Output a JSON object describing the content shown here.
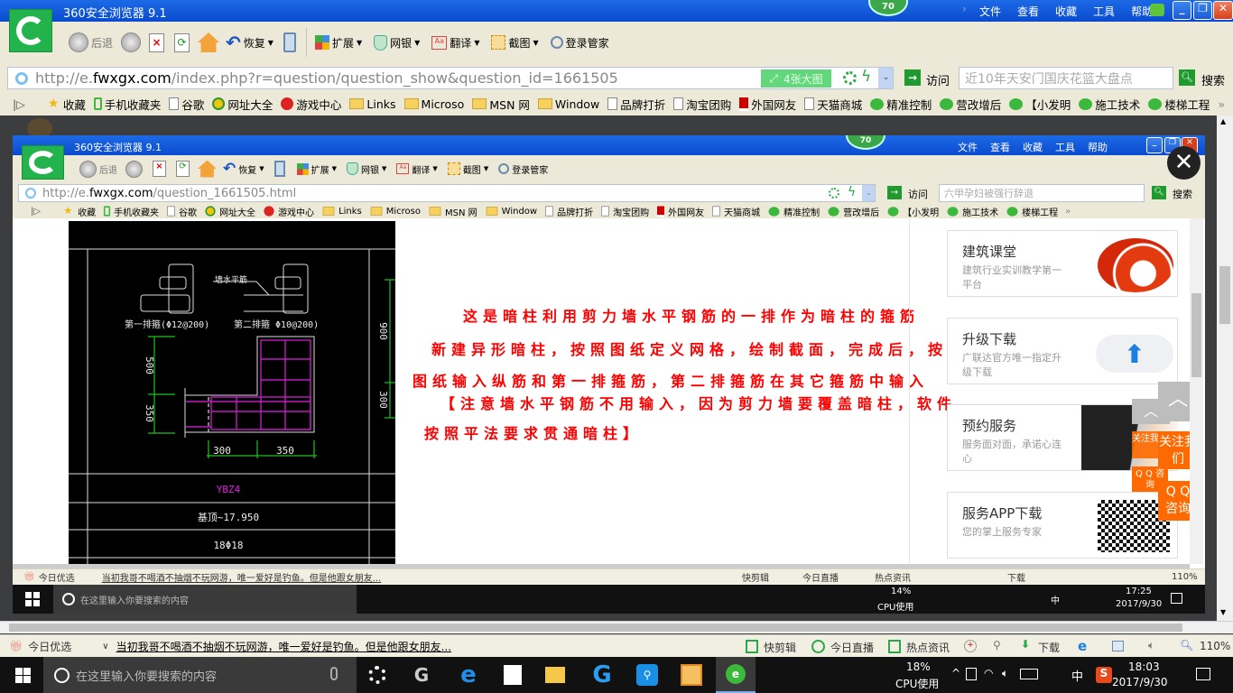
{
  "outer_browser": {
    "title": "360安全浏览器 9.1",
    "badge": "70",
    "menu": [
      "文件",
      "查看",
      "收藏",
      "工具",
      "帮助"
    ],
    "toolbar": {
      "back": "后退",
      "restore": "恢复",
      "extend": "扩展",
      "bank": "网银",
      "translate": "翻译",
      "screenshot": "截图",
      "login": "登录管家"
    },
    "address": {
      "prefix": "http://e.",
      "domain": "fwxgx.com",
      "path": "/index.php?r=question/question_show&question_id=1661505",
      "big_image": "4张大图",
      "go": "访问",
      "search_placeholder": "近10年天安门国庆花篮大盘点",
      "search": "搜索"
    },
    "bookmarks": [
      {
        "label": "收藏",
        "icon": "star"
      },
      {
        "label": "手机收藏夹",
        "icon": "phone"
      },
      {
        "label": "谷歌",
        "icon": "page"
      },
      {
        "label": "网址大全",
        "icon": "plus"
      },
      {
        "label": "游戏中心",
        "icon": "game"
      },
      {
        "label": "Links",
        "icon": "folder"
      },
      {
        "label": "Microso",
        "icon": "folder"
      },
      {
        "label": "MSN 网",
        "icon": "folder"
      },
      {
        "label": "Window",
        "icon": "folder"
      },
      {
        "label": "品牌打折",
        "icon": "page"
      },
      {
        "label": "淘宝团购",
        "icon": "page"
      },
      {
        "label": "外国网友",
        "icon": "flag"
      },
      {
        "label": "天猫商城",
        "icon": "page"
      },
      {
        "label": "精准控制",
        "icon": "wechat"
      },
      {
        "label": "营改增后",
        "icon": "wechat"
      },
      {
        "label": "【小发明",
        "icon": "wechat"
      },
      {
        "label": "施工技术",
        "icon": "wechat"
      },
      {
        "label": "楼梯工程",
        "icon": "wechat"
      }
    ]
  },
  "inner_browser": {
    "title": "360安全浏览器 9.1",
    "badge": "70",
    "menu": [
      "文件",
      "查看",
      "收藏",
      "工具",
      "帮助"
    ],
    "toolbar": {
      "back": "后退",
      "restore": "恢复",
      "extend": "扩展",
      "bank": "网银",
      "translate": "翻译",
      "screenshot": "截图",
      "login": "登录管家"
    },
    "address": {
      "prefix": "http://e.",
      "domain": "fwxgx.com",
      "path": "/question_1661505.html",
      "go": "访问",
      "search_placeholder": "六甲孕妇被强行辞退",
      "search": "搜索"
    }
  },
  "drawing": {
    "rebar_label": "墙水平筋",
    "stirrup_1": "第一排箍(Φ12@200)",
    "stirrup_2": "第二排箍 Φ10@200)",
    "dim_500": "500",
    "dim_350_v": "350",
    "dim_300": "300",
    "dim_350_h": "350",
    "dim_900": "900",
    "dim_300_r": "300",
    "name": "YBZ4",
    "elevation": "基顶~17.950",
    "rebar": "18Φ18"
  },
  "content_text": [
    "这是暗柱利用剪力墙水平钢筋的一排作为暗柱的箍筋",
    "新建异形暗柱，按照图纸定义网格，绘制截面，完成后，按照",
    "图纸输入纵筋和第一排箍筋，第二排箍筋在其它箍筋中输入",
    "【注意墙水平钢筋不用输入，因为剪力墙要覆盖暗柱，软件",
    "按照平法要求贯通暗柱】"
  ],
  "sidebar": [
    {
      "title": "建筑课堂",
      "desc": "建筑行业实训教学第一平台"
    },
    {
      "title": "升级下载",
      "desc": "广联达官方唯一指定升级下载"
    },
    {
      "title": "预约服务",
      "desc": "服务面对面，承诺心连心"
    },
    {
      "title": "服务APP下载",
      "desc": "您的掌上服务专家"
    }
  ],
  "float_buttons": {
    "follow": "关注我们",
    "qq": "Q Q 咨询"
  },
  "status_bar": {
    "today": "今日优选",
    "news": "当初我哥不喝酒不抽烟不玩网游，唯一爱好是钓鱼。但是他跟女朋友...",
    "items": [
      "快剪辑",
      "今日直播",
      "热点资讯",
      "下载"
    ],
    "zoom": "110%"
  },
  "taskbar": {
    "search_placeholder": "在这里输入你要搜索的内容",
    "cpu": "18%",
    "cpu_label": "CPU使用",
    "ime": "中",
    "time": "18:03",
    "date": "2017/9/30"
  },
  "inner_taskbar": {
    "search_placeholder": "在这里输入你要搜索的内容",
    "cpu": "14%",
    "cpu_label": "CPU使用",
    "ime": "中",
    "time": "17:25",
    "date": "2017/9/30"
  },
  "colors": {
    "title_blue": "#0a4bcf",
    "accent_green": "#22b34d",
    "text_red": "#ff0000",
    "orange": "#ff6a00",
    "cad_magenta": "#e020e0",
    "cad_green": "#20c020"
  }
}
